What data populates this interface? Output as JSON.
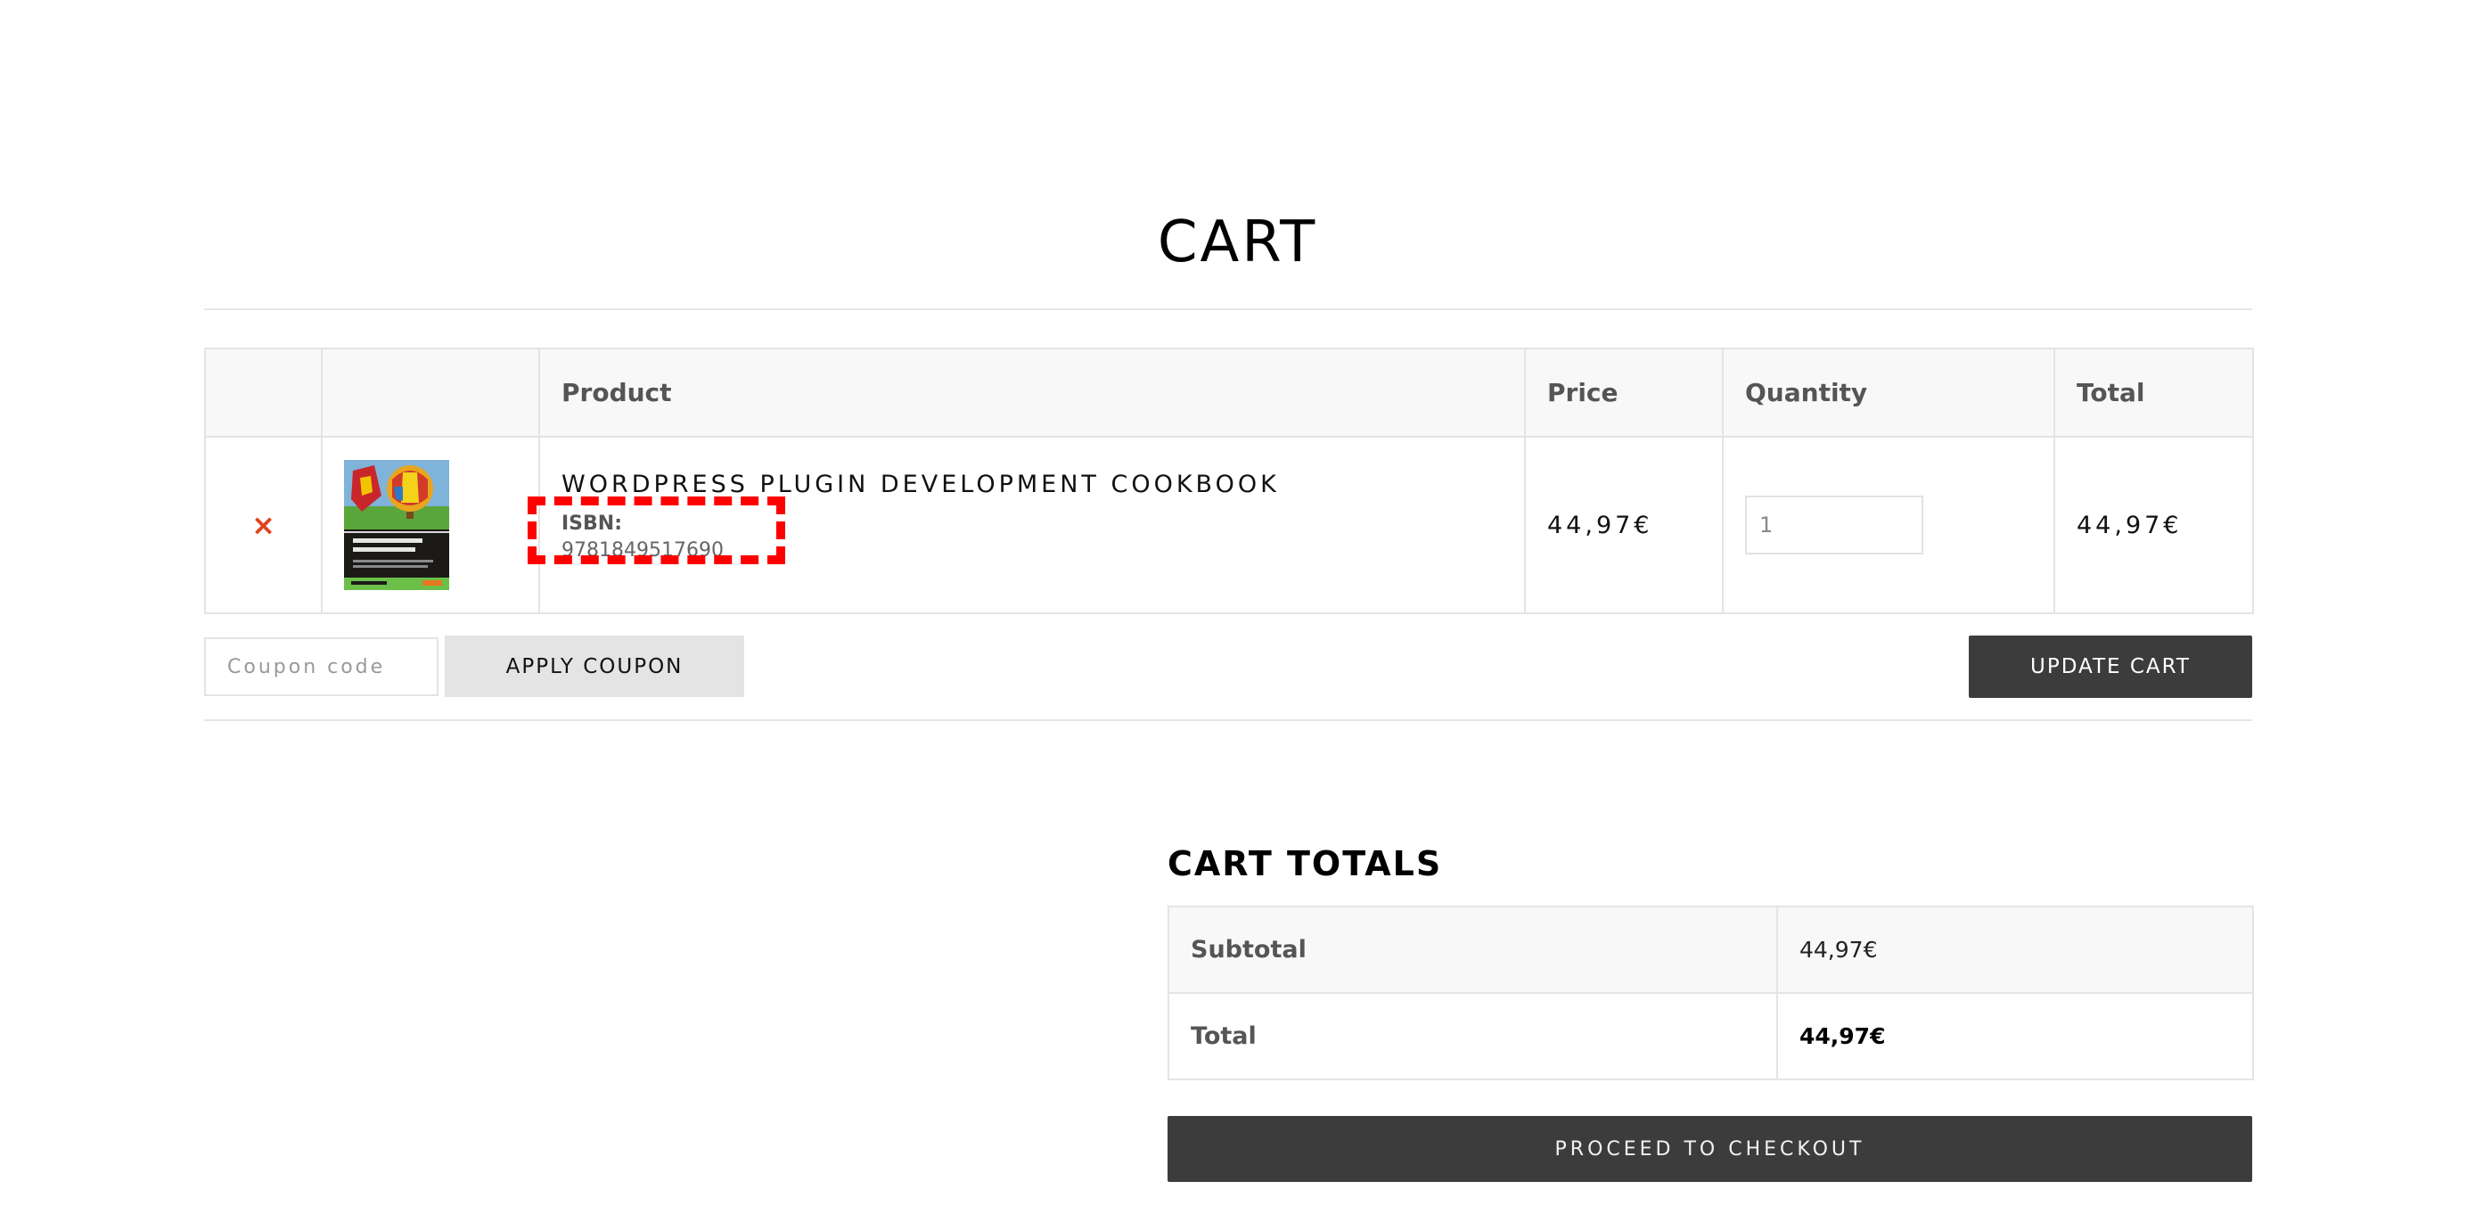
{
  "page": {
    "title": "CART"
  },
  "cart": {
    "headers": {
      "remove": "",
      "thumbnail": "",
      "product": "Product",
      "price": "Price",
      "quantity": "Quantity",
      "total": "Total"
    },
    "items": [
      {
        "remove_symbol": "×",
        "name": "WORDPRESS PLUGIN DEVELOPMENT COOKBOOK",
        "meta_label": "ISBN:",
        "meta_value": "9781849517690",
        "price": "44,97€",
        "quantity": "1",
        "total": "44,97€",
        "thumbnail_icon": "book-cover-image"
      }
    ]
  },
  "actions": {
    "coupon_placeholder": "Coupon code",
    "apply_coupon_label": "APPLY COUPON",
    "update_cart_label": "UPDATE CART"
  },
  "totals": {
    "title": "CART TOTALS",
    "subtotal_label": "Subtotal",
    "subtotal_value": "44,97€",
    "total_label": "Total",
    "total_value": "44,97€",
    "checkout_label": "PROCEED TO CHECKOUT"
  },
  "colors": {
    "remove": "#e2401c",
    "button_dark": "#3c3c3c",
    "button_light": "#e4e4e4",
    "highlight": "#ff0000"
  }
}
